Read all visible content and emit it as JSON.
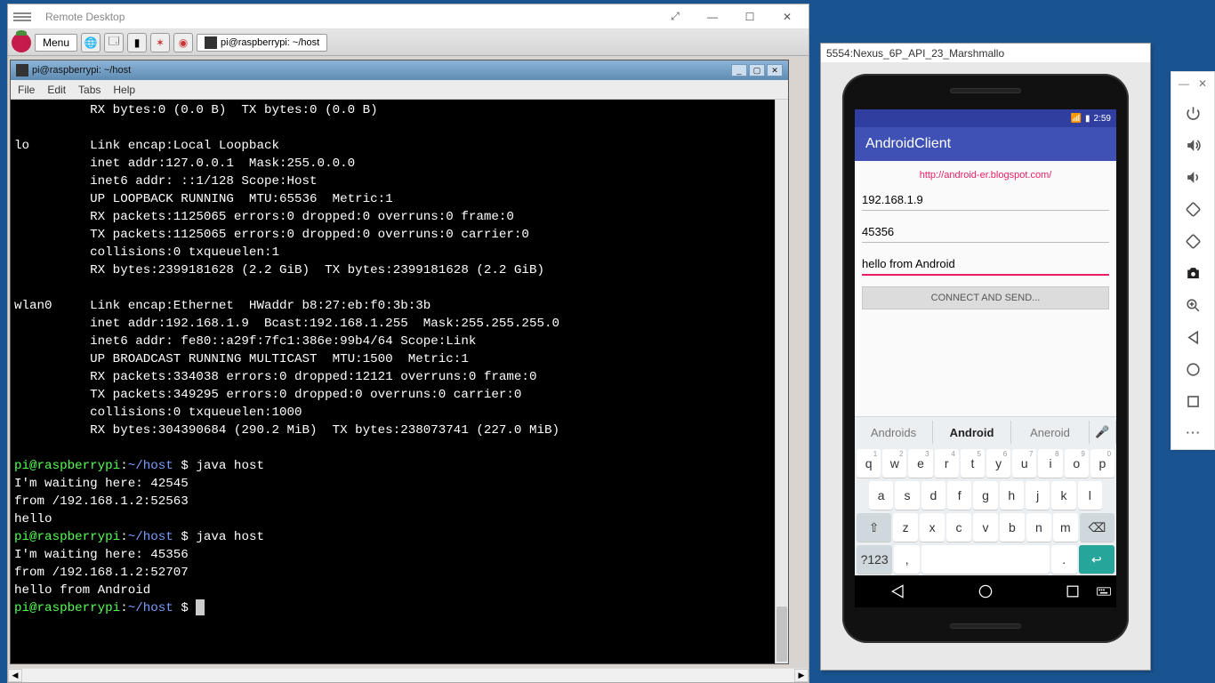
{
  "rd": {
    "title": "Remote Desktop",
    "win_min": "—",
    "win_max": "☐",
    "win_close": "✕",
    "win_expand": "⤢"
  },
  "rpi": {
    "menu_label": "Menu",
    "task_label": "pi@raspberrypi: ~/host"
  },
  "term": {
    "title": "pi@raspberrypi: ~/host",
    "menu_file": "File",
    "menu_edit": "Edit",
    "menu_tabs": "Tabs",
    "menu_help": "Help",
    "lines_pre1": "          RX bytes:0 (0.0 B)  TX bytes:0 (0.0 B)\n\nlo        Link encap:Local Loopback\n          inet addr:127.0.0.1  Mask:255.0.0.0\n          inet6 addr: ::1/128 Scope:Host\n          UP LOOPBACK RUNNING  MTU:65536  Metric:1\n          RX packets:1125065 errors:0 dropped:0 overruns:0 frame:0\n          TX packets:1125065 errors:0 dropped:0 overruns:0 carrier:0\n          collisions:0 txqueuelen:1\n          RX bytes:2399181628 (2.2 GiB)  TX bytes:2399181628 (2.2 GiB)\n\nwlan0     Link encap:Ethernet  HWaddr b8:27:eb:f0:3b:3b\n          inet addr:192.168.1.9  Bcast:192.168.1.255  Mask:255.255.255.0\n          inet6 addr: fe80::a29f:7fc1:386e:99b4/64 Scope:Link\n          UP BROADCAST RUNNING MULTICAST  MTU:1500  Metric:1\n          RX packets:334038 errors:0 dropped:12121 overruns:0 frame:0\n          TX packets:349295 errors:0 dropped:0 overruns:0 carrier:0\n          collisions:0 txqueuelen:1000\n          RX bytes:304390684 (290.2 MiB)  TX bytes:238073741 (227.0 MiB)\n",
    "p_user": "pi@raspberrypi",
    "p_sep1": ":",
    "p_path": "~/host",
    "p_sep2": " $ ",
    "cmd1": "java host",
    "out1": "I'm waiting here: 42545\nfrom /192.168.1.2:52563\nhello",
    "cmd2": "java host",
    "out2": "I'm waiting here: 45356\nfrom /192.168.1.2:52707\nhello from Android"
  },
  "emu": {
    "title": "5554:Nexus_6P_API_23_Marshmallo"
  },
  "phone": {
    "status_time": "2:59",
    "app_title": "AndroidClient",
    "link": "http://android-er.blogspot.com/",
    "ip": "192.168.1.9",
    "port": "45356",
    "msg": "hello from Android",
    "btn": "CONNECT AND SEND...",
    "sug1": "Androids",
    "sug2": "Android",
    "sug3": "Aneroid",
    "row1": [
      "q",
      "w",
      "e",
      "r",
      "t",
      "y",
      "u",
      "i",
      "o",
      "p"
    ],
    "row1s": [
      "1",
      "2",
      "3",
      "4",
      "5",
      "6",
      "7",
      "8",
      "9",
      "0"
    ],
    "row2": [
      "a",
      "s",
      "d",
      "f",
      "g",
      "h",
      "j",
      "k",
      "l"
    ],
    "row3": [
      "z",
      "x",
      "c",
      "v",
      "b",
      "n",
      "m"
    ],
    "shift": "⇧",
    "backspace": "⌫",
    "numkey": "?123",
    "comma": ",",
    "period": ".",
    "enter": "↩"
  },
  "side": {
    "min": "—",
    "close": "✕"
  }
}
